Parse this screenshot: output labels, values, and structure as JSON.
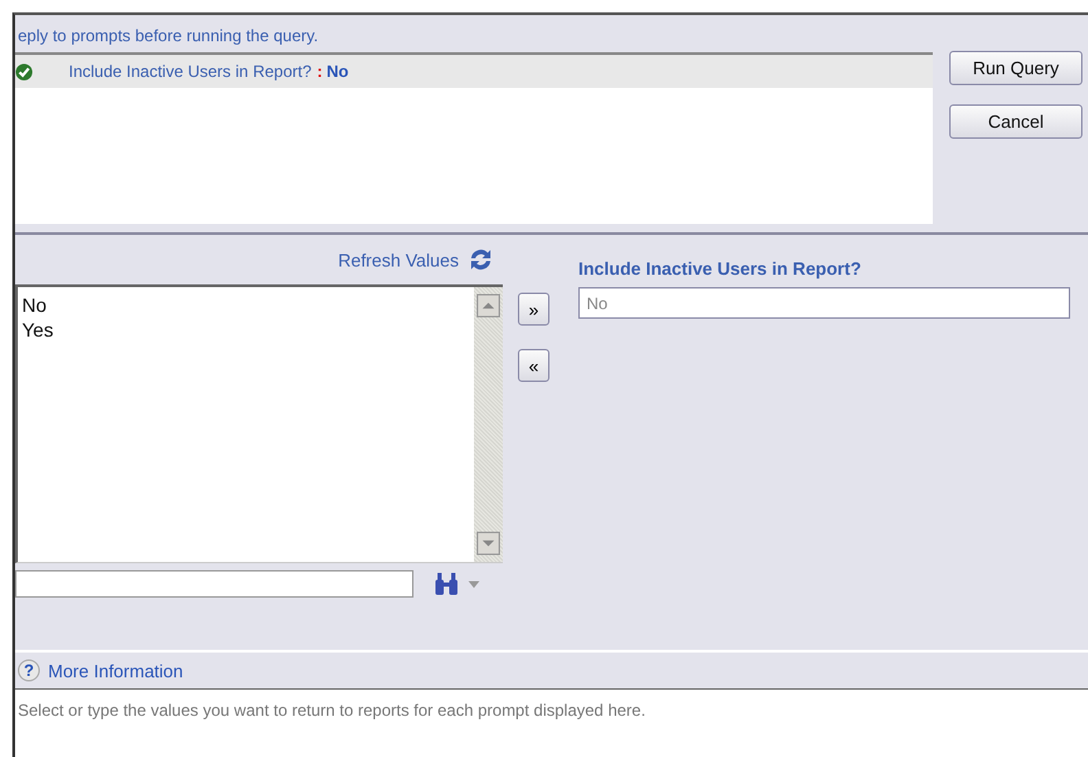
{
  "instruction": "eply to prompts before running the query.",
  "prompts": [
    {
      "answered": true,
      "label": "Include Inactive Users in Report?",
      "separator": ":",
      "value": "No",
      "selected": false
    }
  ],
  "buttons": [
    "Run Query",
    "Cancel"
  ],
  "refresh_label": "Refresh Values",
  "values": [
    {
      "label": "No",
      "selected": false
    },
    {
      "label": "Yes",
      "selected": false
    }
  ],
  "help_icon": "?",
  "add_button": "»",
  "remove_button": "«",
  "prompt_title": "Include Inactive Users in Report?",
  "selected_value": {
    "value": "No"
  },
  "more_info": "More Information",
  "description": "Select or type the values you want to return to reports for each prompt displayed here."
}
